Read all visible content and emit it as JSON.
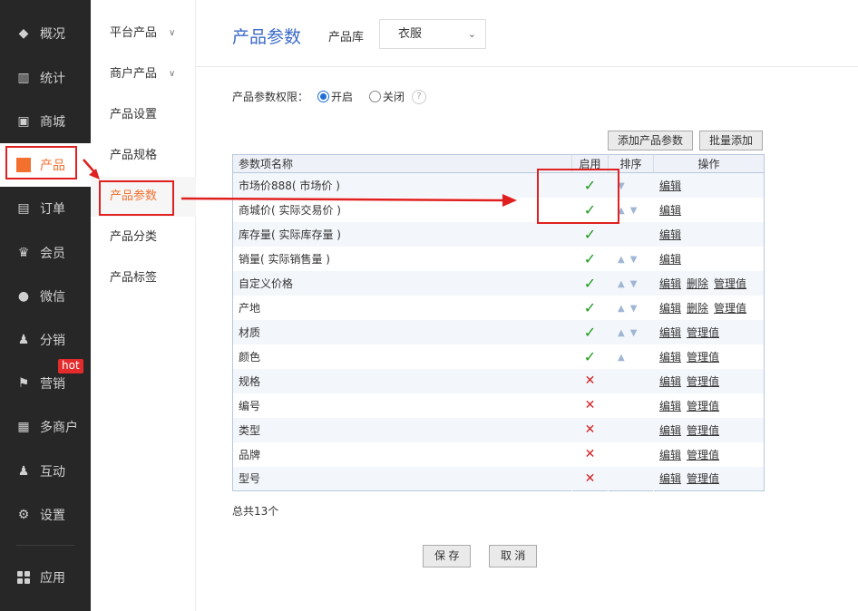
{
  "nav": {
    "items": [
      {
        "label": "概况",
        "icon": "layers-icon"
      },
      {
        "label": "统计",
        "icon": "chart-icon"
      },
      {
        "label": "商城",
        "icon": "store-icon"
      },
      {
        "label": "产品",
        "icon": "grid-icon",
        "active": true
      },
      {
        "label": "订单",
        "icon": "order-icon"
      },
      {
        "label": "会员",
        "icon": "crown-icon"
      },
      {
        "label": "微信",
        "icon": "wechat-icon"
      },
      {
        "label": "分销",
        "icon": "users-icon"
      },
      {
        "label": "营销",
        "icon": "flag-icon"
      },
      {
        "label": "多商户",
        "icon": "building-icon"
      },
      {
        "label": "互动",
        "icon": "people-icon"
      },
      {
        "label": "设置",
        "icon": "gear-icon"
      },
      {
        "label": "应用",
        "icon": "apps-icon"
      }
    ],
    "hot_badge": "hot"
  },
  "subnav": {
    "items": [
      {
        "label": "平台产品",
        "expandable": true
      },
      {
        "label": "商户产品",
        "expandable": true
      },
      {
        "label": "产品设置"
      },
      {
        "label": "产品规格"
      },
      {
        "label": "产品参数",
        "active": true
      },
      {
        "label": "产品分类"
      },
      {
        "label": "产品标签"
      }
    ]
  },
  "header": {
    "title": "产品参数",
    "lib_label": "产品库",
    "lib_value": "衣服"
  },
  "permission": {
    "label": "产品参数权限：",
    "on_label": "开启",
    "off_label": "关闭",
    "selected": "on",
    "help": "?"
  },
  "toolbar": {
    "add_label": "添加产品参数",
    "batch_label": "批量添加"
  },
  "table": {
    "headers": {
      "name": "参数项名称",
      "enabled": "启用",
      "sort": "排序",
      "ops": "操作"
    },
    "rows": [
      {
        "name": "市场价888( 市场价 )",
        "enabled": true,
        "up": false,
        "down": true,
        "ops": [
          "编辑"
        ]
      },
      {
        "name": "商城价( 实际交易价 )",
        "enabled": true,
        "up": true,
        "down": true,
        "ops": [
          "编辑"
        ]
      },
      {
        "name": "库存量( 实际库存量 )",
        "enabled": true,
        "up": false,
        "down": false,
        "ops": [
          "编辑"
        ]
      },
      {
        "name": "销量( 实际销售量 )",
        "enabled": true,
        "up": true,
        "down": true,
        "ops": [
          "编辑"
        ]
      },
      {
        "name": "自定义价格",
        "enabled": true,
        "up": true,
        "down": true,
        "ops": [
          "编辑",
          "删除",
          "管理值"
        ]
      },
      {
        "name": "产地",
        "enabled": true,
        "up": true,
        "down": true,
        "ops": [
          "编辑",
          "删除",
          "管理值"
        ]
      },
      {
        "name": "材质",
        "enabled": true,
        "up": true,
        "down": true,
        "ops": [
          "编辑",
          "管理值"
        ]
      },
      {
        "name": "颜色",
        "enabled": true,
        "up": true,
        "down": false,
        "ops": [
          "编辑",
          "管理值"
        ]
      },
      {
        "name": "规格",
        "enabled": false,
        "up": false,
        "down": false,
        "ops": [
          "编辑",
          "管理值"
        ]
      },
      {
        "name": "编号",
        "enabled": false,
        "up": false,
        "down": false,
        "ops": [
          "编辑",
          "管理值"
        ]
      },
      {
        "name": "类型",
        "enabled": false,
        "up": false,
        "down": false,
        "ops": [
          "编辑",
          "管理值"
        ]
      },
      {
        "name": "品牌",
        "enabled": false,
        "up": false,
        "down": false,
        "ops": [
          "编辑",
          "管理值"
        ]
      },
      {
        "name": "型号",
        "enabled": false,
        "up": false,
        "down": false,
        "ops": [
          "编辑",
          "管理值"
        ]
      }
    ],
    "check_glyph": "✓",
    "cross_glyph": "✕",
    "up_glyph": "▲",
    "down_glyph": "▼"
  },
  "footer": {
    "total": "总共13个",
    "save_label": "保 存",
    "cancel_label": "取 消"
  },
  "colors": {
    "accent": "#f3702f",
    "annotation": "#e02020",
    "title_blue": "#3b6ac9"
  }
}
